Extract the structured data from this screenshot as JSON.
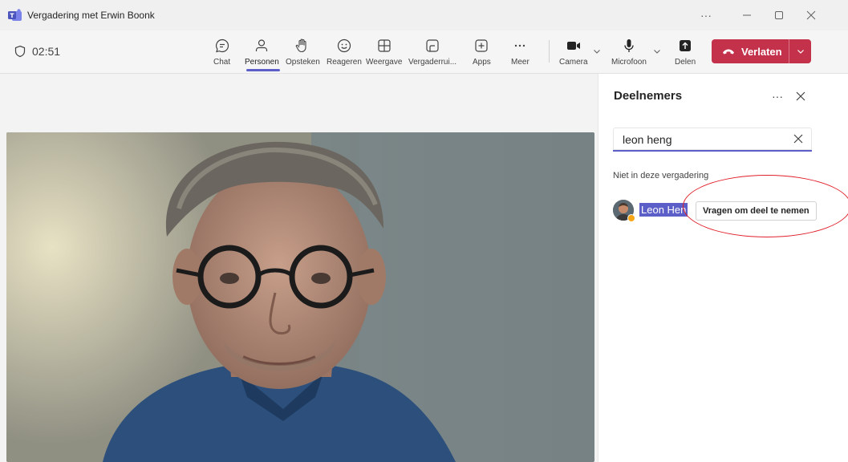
{
  "window": {
    "title": "Vergadering met Erwin Boonk",
    "more_icon": "more-horizontal-icon",
    "minimize_icon": "minimize-icon",
    "maximize_icon": "maximize-icon",
    "close_icon": "close-icon"
  },
  "toolbar": {
    "timer": "02:51",
    "buttons": {
      "chat": "Chat",
      "people": "Personen",
      "raise": "Opsteken",
      "react": "Reageren",
      "view": "Weergave",
      "rooms": "Vergaderrui...",
      "apps": "Apps",
      "more": "Meer",
      "camera": "Camera",
      "mic": "Microfoon",
      "share": "Delen"
    },
    "leave_label": "Verlaten",
    "active_tab": "Personen"
  },
  "panel": {
    "title": "Deelnemers",
    "search_value": "leon heng",
    "section_label": "Niet in deze vergadering",
    "participant": {
      "name": "Leon Hen",
      "presence": "away",
      "action_label": "Vragen om deel te nemen"
    }
  },
  "colors": {
    "accent": "#5b5fc7",
    "leave": "#c4314b",
    "annotation": "#e0202a"
  }
}
